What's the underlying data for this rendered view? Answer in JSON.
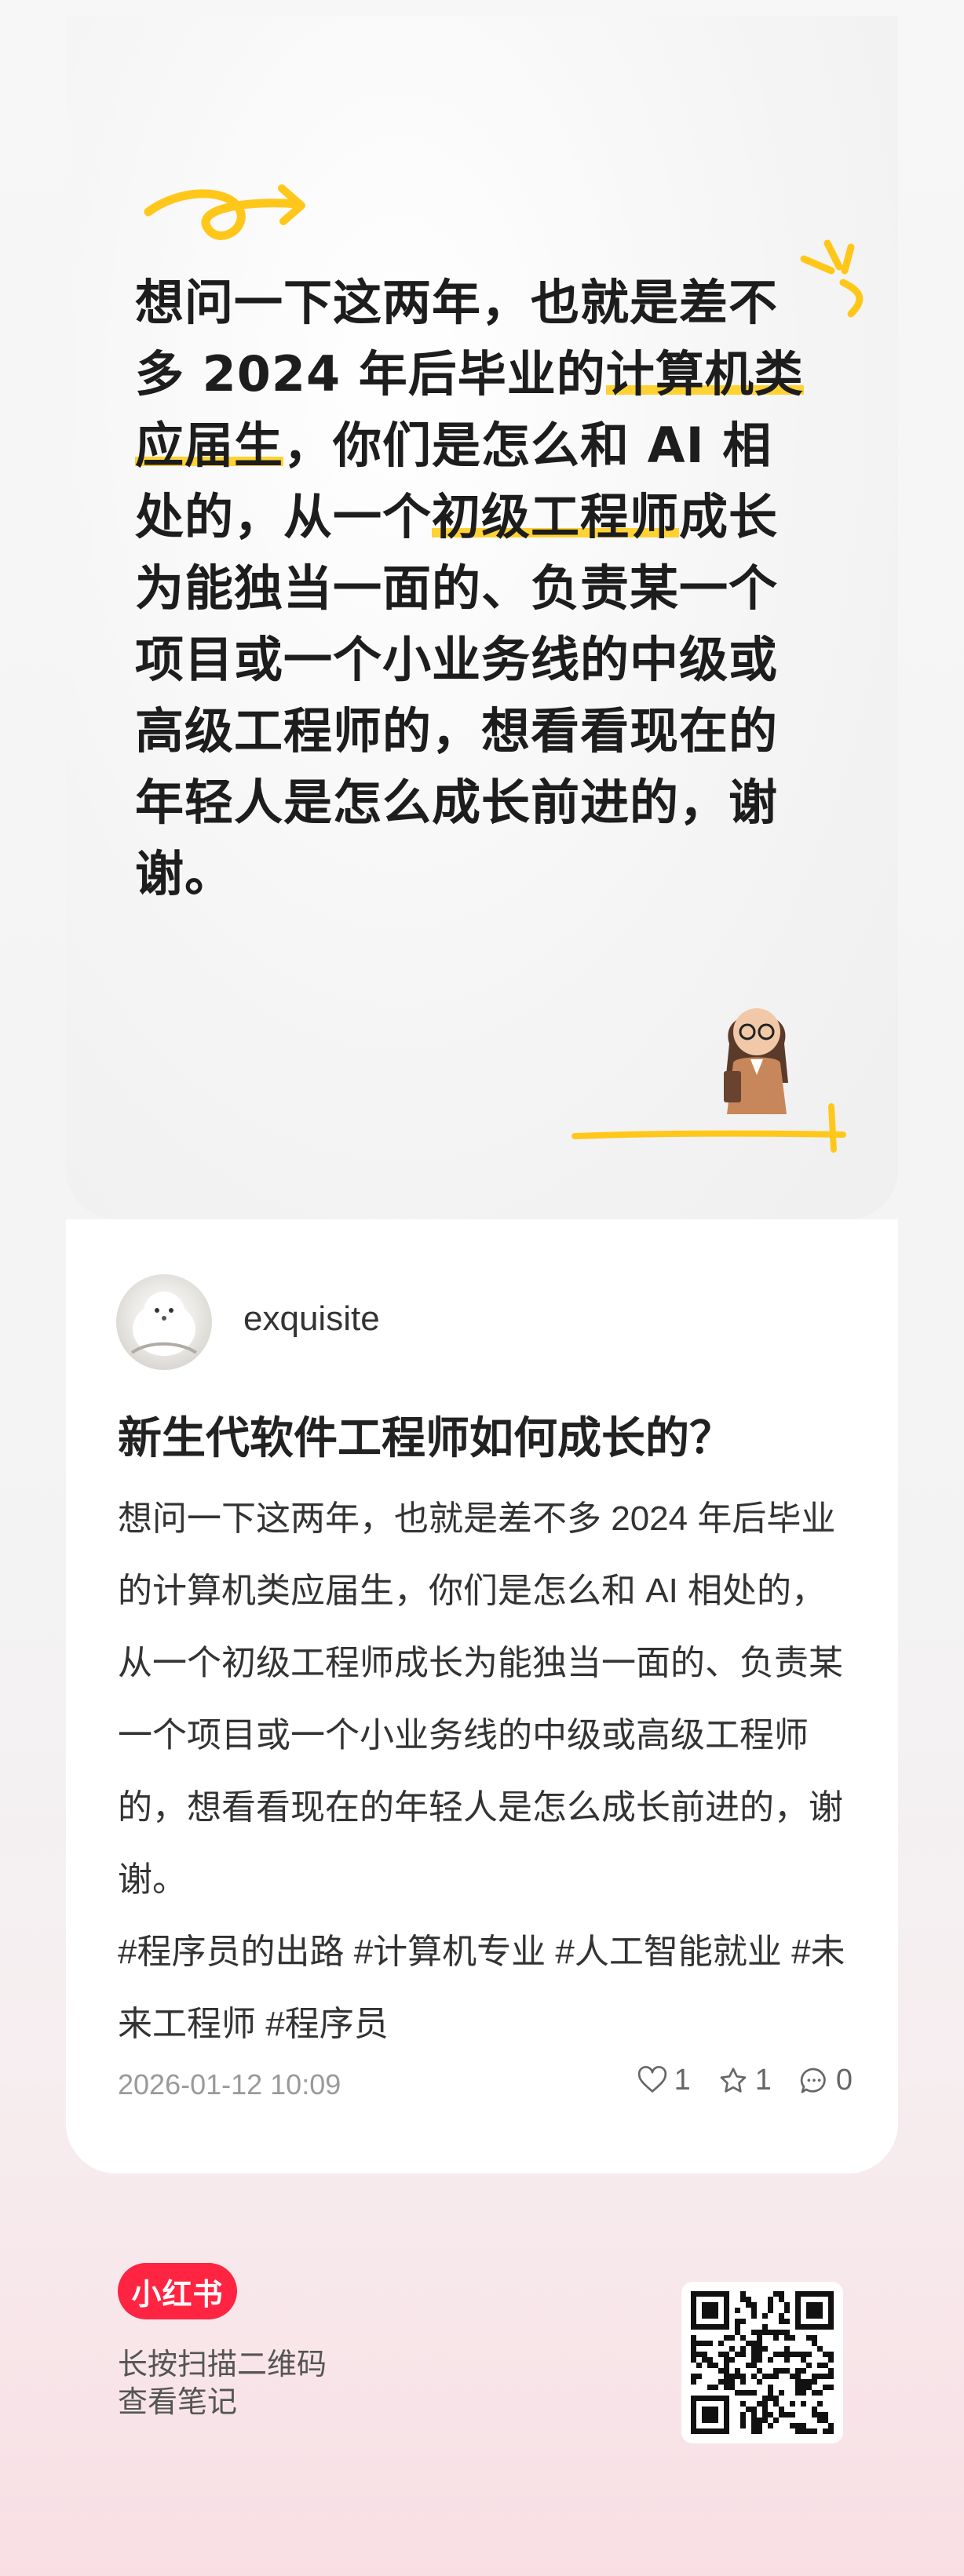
{
  "cover": {
    "lines": [
      {
        "parts": [
          {
            "text": "想问一下这两年，也就是差不",
            "hl": false
          }
        ]
      },
      {
        "parts": [
          {
            "text": "多 2024 年后毕业的",
            "hl": false
          },
          {
            "text": "计算机类",
            "hl": true
          }
        ]
      },
      {
        "parts": [
          {
            "text": "应届生",
            "hl": true
          },
          {
            "text": "，你们是怎么和 AI 相",
            "hl": false
          }
        ]
      },
      {
        "parts": [
          {
            "text": "处的，从一个",
            "hl": false
          },
          {
            "text": "初级工程师",
            "hl": true
          },
          {
            "text": "成长",
            "hl": false
          }
        ]
      },
      {
        "parts": [
          {
            "text": "为能独当一面的、负责某一个",
            "hl": false
          }
        ]
      },
      {
        "parts": [
          {
            "text": "项目或一个小业务线的中级或",
            "hl": false
          }
        ]
      },
      {
        "parts": [
          {
            "text": "高级工程师的，想看看现在的",
            "hl": false
          }
        ]
      },
      {
        "parts": [
          {
            "text": "年轻人是怎么成长前进的，谢",
            "hl": false
          }
        ]
      },
      {
        "parts": [
          {
            "text": "谢。",
            "hl": false
          }
        ]
      }
    ],
    "accent_color": "#ffd233"
  },
  "post": {
    "username": "exquisite",
    "title": "新生代软件工程师如何成长的？",
    "body": "想问一下这两年，也就是差不多 2024 年后毕业的计算机类应届生，你们是怎么和 AI 相处的，从一个初级工程师成长为能独当一面的、负责某一个项目或一个小业务线的中级或高级工程师的，想看看现在的年轻人是怎么成长前进的，谢谢。",
    "tags": "#程序员的出路 #计算机专业 #人工智能就业 #未来工程师 #程序员",
    "timestamp": "2026-01-12 10:09",
    "likes": "1",
    "favorites": "1",
    "comments": "0"
  },
  "footer": {
    "logo_text": "小红书",
    "hint_line1": "长按扫描二维码",
    "hint_line2": "查看笔记",
    "brand_color": "#ff2442"
  }
}
